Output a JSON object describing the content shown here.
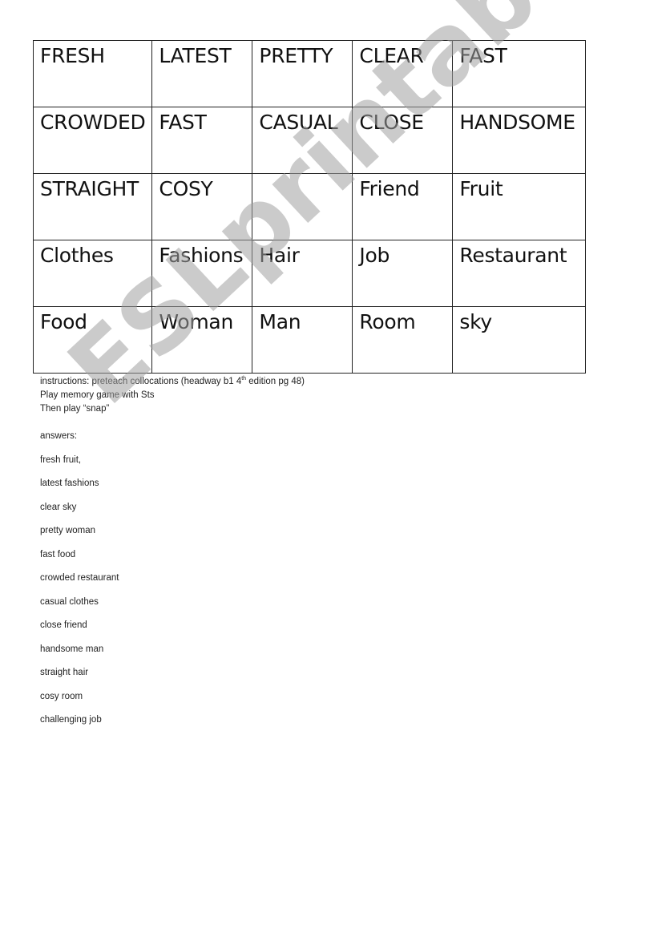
{
  "grid": [
    [
      "FRESH",
      "LATEST",
      "PRETTY",
      "CLEAR",
      "FAST"
    ],
    [
      "CROWDED",
      "FAST",
      "CASUAL",
      "CLOSE",
      "HANDSOME"
    ],
    [
      "STRAIGHT",
      "COSY",
      "",
      "Friend",
      "Fruit"
    ],
    [
      "Clothes",
      "Fashions",
      "Hair",
      "Job",
      "Restaurant"
    ],
    [
      "Food",
      "Woman",
      "Man",
      "Room",
      "sky"
    ]
  ],
  "instructions": {
    "line1_pre": "instructions:  preteach collocations (headway b1 4",
    "line1_sup": "th",
    "line1_post": " edition pg 48)",
    "line2": "Play memory game with Sts",
    "line3": "Then play “snap”"
  },
  "answers_label": "answers:",
  "answers": [
    " fresh fruit,",
    "latest fashions",
    "clear sky",
    "pretty woman",
    "fast food",
    "crowded restaurant",
    "casual clothes",
    "close friend",
    "handsome man",
    "straight hair",
    "cosy room",
    "challenging job"
  ],
  "watermark": "ESLprintables.com"
}
